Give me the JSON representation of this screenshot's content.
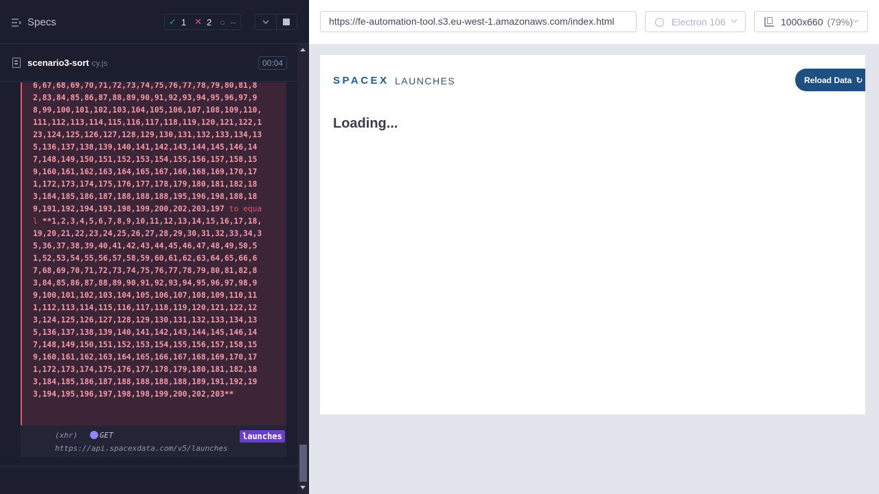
{
  "reporter": {
    "specs_label": "Specs",
    "stats": {
      "passed": "1",
      "failed": "2",
      "pending": "--"
    },
    "spec": {
      "name": "scenario3-sort",
      "ext": "cy.js",
      "duration": "00:04"
    },
    "error": {
      "actual_text": "6,67,68,69,70,71,72,73,74,75,76,77,78,79,80,81,82,83,84,85,86,87,88,89,90,91,92,93,94,95,96,97,98,99,100,101,102,103,104,105,106,107,108,109,110,111,112,113,114,115,116,117,118,119,120,121,122,123,124,125,126,127,128,129,130,131,132,133,134,135,136,137,138,139,140,141,142,143,144,145,146,147,148,149,150,151,152,153,154,155,156,157,158,159,160,161,162,163,164,165,167,166,168,169,170,171,172,173,174,175,176,177,178,179,180,181,182,183,184,185,186,187,188,188,188,195,196,198,188,189,191,192,194,193,198,199,200,202,203,197",
      "to_equal": " to equal ",
      "expected_text": "**1,2,3,4,5,6,7,8,9,10,11,12,13,14,15,16,17,18,19,20,21,22,23,24,25,26,27,28,29,30,31,32,33,34,35,36,37,38,39,40,41,42,43,44,45,46,47,48,49,50,51,52,53,54,55,56,57,58,59,60,61,62,63,64,65,66,67,68,69,70,71,72,73,74,75,76,77,78,79,80,81,82,83,84,85,86,87,88,89,90,91,92,93,94,95,96,97,98,99,100,101,102,103,104,105,106,107,108,109,110,111,112,113,114,115,116,117,118,119,120,121,122,123,124,125,126,127,128,129,130,131,132,133,134,135,136,137,138,139,140,141,142,143,144,145,146,147,148,149,150,151,152,153,154,155,156,157,158,159,160,161,162,163,164,165,166,167,168,169,170,171,172,173,174,175,176,177,178,179,180,181,182,183,184,185,186,187,188,188,188,188,189,191,192,193,194,195,196,197,198,198,199,200,202,203**"
    },
    "command": {
      "type": "(xhr)",
      "method": "GET",
      "alias": "launches",
      "url": "https://api.spacexdata.com/v5/launches"
    }
  },
  "aut": {
    "url": "https://fe-automation-tool.s3.eu-west-1.amazonaws.com/index.html",
    "browser": "Electron 106",
    "viewport": {
      "size": "1000x660",
      "scale": "(79%)"
    },
    "app": {
      "logo": "SPACEX",
      "logo_suffix": "LAUNCHES",
      "reload_label": "Reload Data",
      "loading": "Loading..."
    }
  },
  "colors": {
    "passed": "#1fa971",
    "failed": "#e45770",
    "accent": "#1d4f80",
    "alias_badge": "#6a3fcf"
  }
}
